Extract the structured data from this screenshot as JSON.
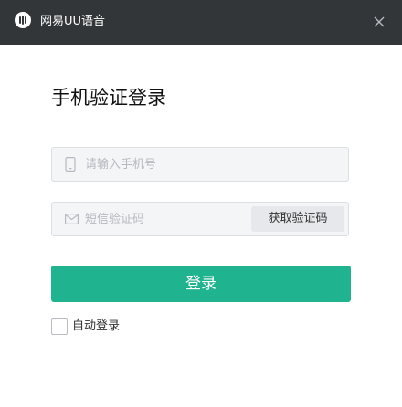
{
  "titlebar": {
    "app_title": "网易UU语音",
    "background": "#333639",
    "logo_icon": "uu-logo-icon",
    "close_icon": "close-icon"
  },
  "login": {
    "title": "手机验证登录",
    "phone": {
      "icon": "mobile-phone-icon",
      "placeholder": "请输入手机号",
      "value": ""
    },
    "code": {
      "icon": "envelope-icon",
      "placeholder": "短信验证码",
      "value": "",
      "get_code_label": "获取验证码"
    },
    "submit_label": "登录",
    "auto_login": {
      "label": "自动登录",
      "checked": false
    }
  },
  "colors": {
    "accent": "#20b38f",
    "field_background": "#f4f5f7",
    "field_border": "#dcdfe3",
    "placeholder_text": "#b6bac0"
  }
}
